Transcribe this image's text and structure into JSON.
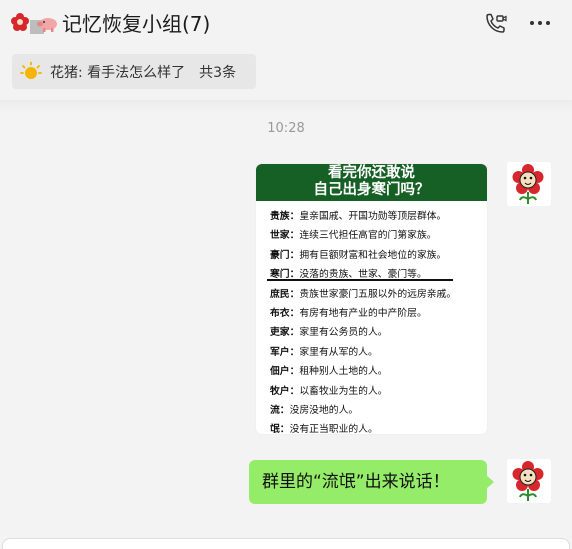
{
  "header": {
    "title": "记忆恢复小组(7)",
    "call_icon": "video-call-icon",
    "more_icon": "more-dots-icon"
  },
  "notice": {
    "icon": "sun-icon",
    "text": "花猪: 看手法怎么样了",
    "count": "共3条"
  },
  "chat": {
    "timestamp": "10:28",
    "image_message": {
      "banner_line1": "看完你还敢说",
      "banner_line2": "自己出身寒门吗？",
      "rows": [
        {
          "term": "贵族",
          "sep": "：",
          "desc": "皇亲国戚、开国功勋等顶层群体。"
        },
        {
          "term": "世家",
          "sep": "：",
          "desc": "连续三代担任高官的门第家族。"
        },
        {
          "term": "豪门",
          "sep": "：",
          "desc": "拥有巨额财富和社会地位的家族。"
        },
        {
          "term": "寒门",
          "sep": "：",
          "desc": "没落的贵族、世家、豪门等。"
        },
        {
          "term": "庶民",
          "sep": "：",
          "desc": "贵族世家豪门五服以外的远房亲戚。"
        },
        {
          "term": "布衣",
          "sep": "：",
          "desc": "有房有地有产业的中产阶层。"
        },
        {
          "term": "吏家",
          "sep": "：",
          "desc": "家里有公务员的人。"
        },
        {
          "term": "军户",
          "sep": "：",
          "desc": "家里有从军的人。"
        },
        {
          "term": "佃户",
          "sep": "：",
          "desc": "租种别人土地的人。"
        },
        {
          "term": "牧户",
          "sep": "：",
          "desc": "以畜牧业为生的人。"
        },
        {
          "term": "流",
          "sep": "：",
          "desc": "没房没地的人。"
        },
        {
          "term": "氓",
          "sep": "：",
          "desc": "没有正当职业的人。"
        }
      ]
    },
    "text_message": "群里的“流氓”出来说话！"
  },
  "colors": {
    "bubble_green": "#95ec69",
    "banner_green": "#165f25",
    "background": "#f3f3f3"
  }
}
